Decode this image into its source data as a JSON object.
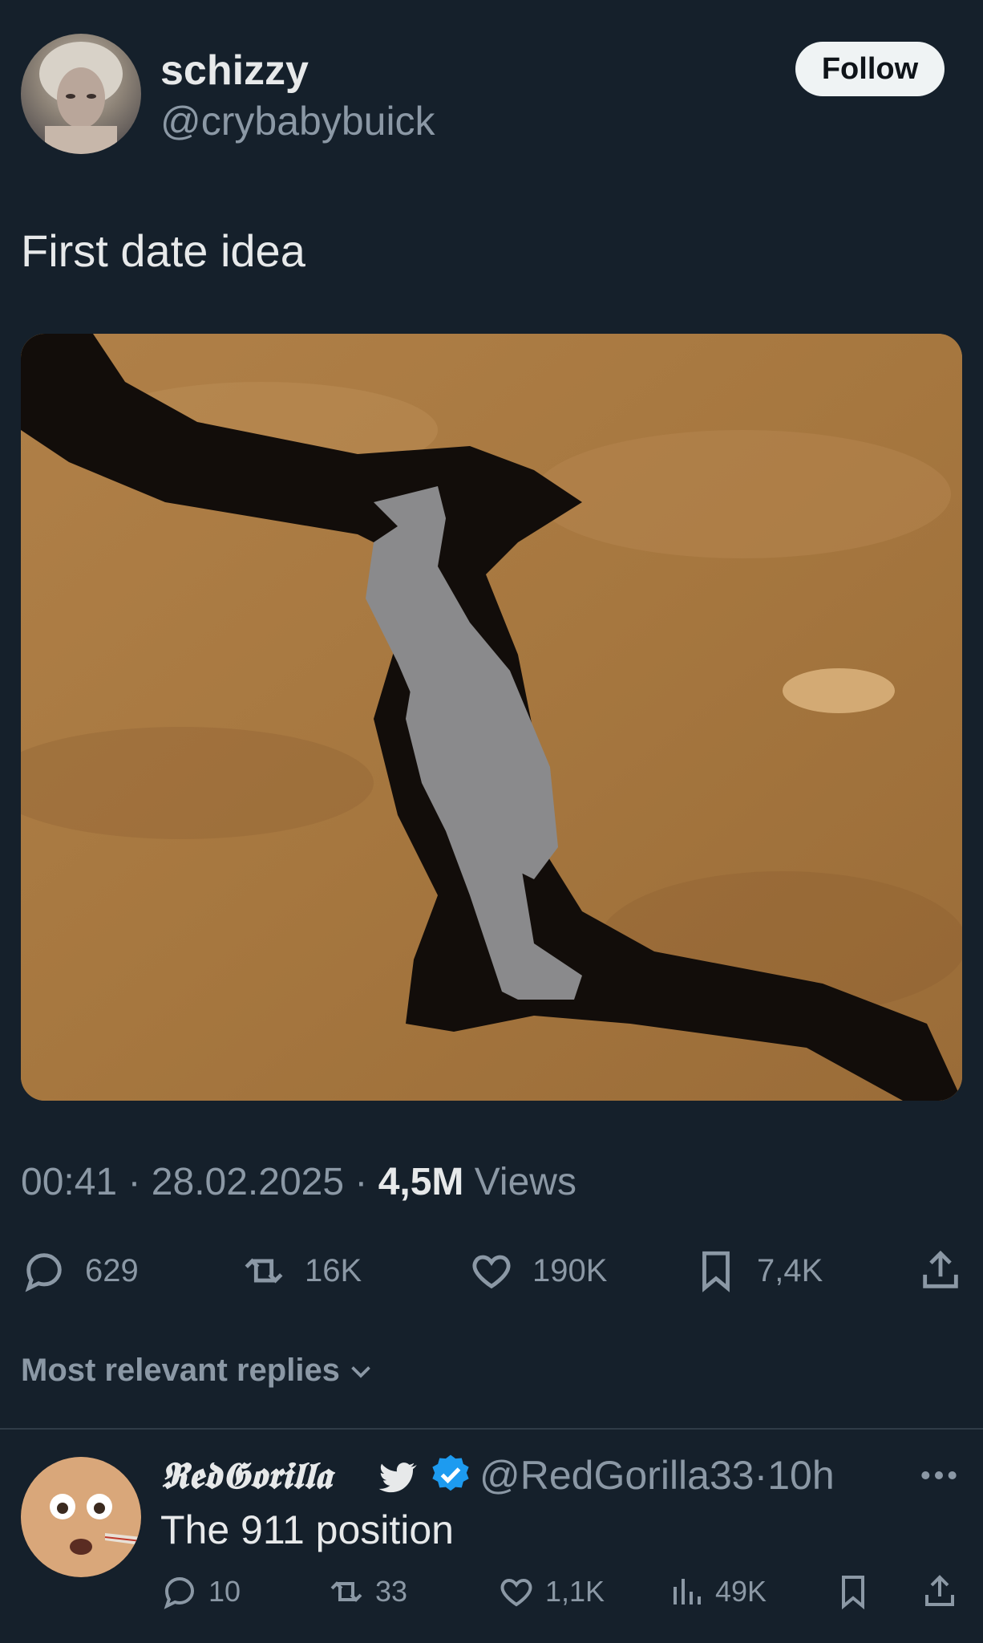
{
  "tweet": {
    "display_name": "schizzy",
    "handle": "@crybabybuick",
    "follow_label": "Follow",
    "text": "First date idea",
    "time": "00:41",
    "date": "28.02.2025",
    "separator": "·",
    "views_count": "4,5M",
    "views_label": "Views",
    "stats": {
      "replies": "629",
      "reposts": "16K",
      "likes": "190K",
      "bookmarks": "7,4K"
    }
  },
  "replies_section": {
    "label": "Most relevant replies"
  },
  "reply": {
    "display_name": "𝕽𝖊𝖉𝕲𝖔𝖗𝖎𝖑𝖑𝖆",
    "handle": "@RedGorilla33",
    "time": "10h",
    "text": "The 911 position",
    "stats": {
      "replies": "10",
      "reposts": "33",
      "likes": "1,1K",
      "views": "49K"
    }
  },
  "colors": {
    "background": "#15202b",
    "text_primary": "#e7e9ea",
    "text_secondary": "#8b98a5",
    "verified": "#1d9bf0",
    "follow_bg": "#eff3f4"
  },
  "icons": [
    "reply-icon",
    "repost-icon",
    "like-icon",
    "bookmark-icon",
    "share-icon",
    "chevron-down-icon",
    "bird-icon",
    "verified-icon",
    "more-icon",
    "views-icon"
  ]
}
